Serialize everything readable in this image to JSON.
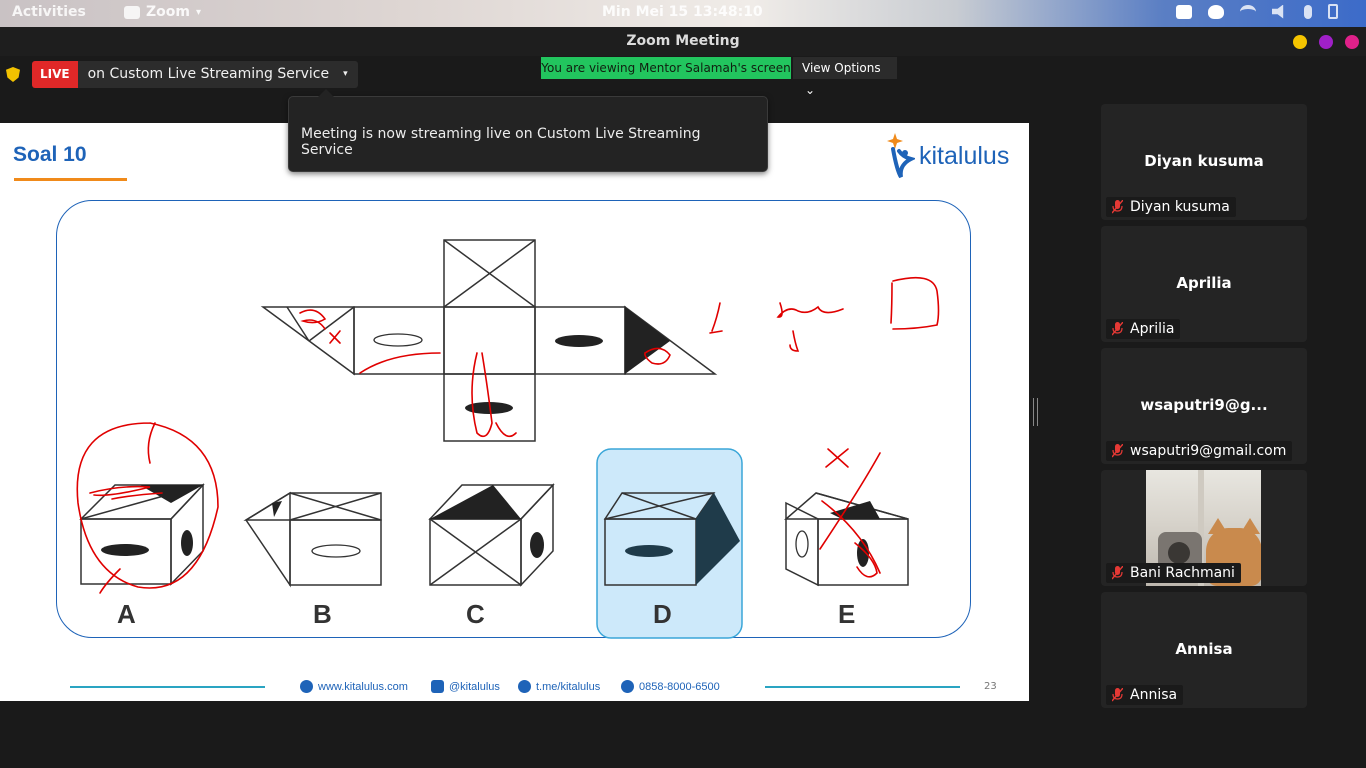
{
  "system_bar": {
    "activities": "Activities",
    "app_name": "Zoom",
    "clock": "Min Mei 15  13:48:10",
    "tray_icons": [
      "zoom-tray-icon",
      "discord-icon",
      "wifi-icon",
      "volume-icon",
      "microphone-icon",
      "battery-icon"
    ]
  },
  "window": {
    "title": "Zoom Meeting",
    "buttons": [
      {
        "name": "minimize",
        "color": "#f5c400"
      },
      {
        "name": "maximize",
        "color": "#a020c8"
      },
      {
        "name": "close",
        "color": "#e0218a"
      }
    ]
  },
  "live": {
    "badge": "LIVE",
    "service": "on Custom Live Streaming Service",
    "caret": "▾"
  },
  "viewing_banner": "You are viewing Mentor Salamah's screen",
  "view_options": {
    "label": "View Options",
    "caret": "⌄"
  },
  "tooltip": "Meeting is now streaming live on Custom Live Streaming Service",
  "slide": {
    "title": "Soal 10",
    "logo_text": "kitalulus",
    "options": [
      "A",
      "B",
      "C",
      "D",
      "E"
    ],
    "selected_option": "D",
    "footer": {
      "website": "www.kitalulus.com",
      "instagram": "@kitalulus",
      "telegram": "t.me/kitalulus",
      "whatsapp": "0858-8000-6500"
    },
    "page_number": "23"
  },
  "participants": [
    {
      "name": "Diyan kusuma",
      "label": "Diyan kusuma",
      "video": false
    },
    {
      "name": "Aprilia",
      "label": "Aprilia",
      "video": false
    },
    {
      "name": "wsaputri9@g...",
      "label": "wsaputri9@gmail.com",
      "video": false
    },
    {
      "name": "",
      "label": "Bani Rachmani",
      "video": true
    },
    {
      "name": "Annisa",
      "label": "Annisa",
      "video": false
    }
  ],
  "colors": {
    "live_red": "#e02828",
    "banner_green": "#22c55e",
    "brand_blue": "#1e63b8",
    "accent_orange": "#f08a1a",
    "muted_red": "#e53935"
  }
}
